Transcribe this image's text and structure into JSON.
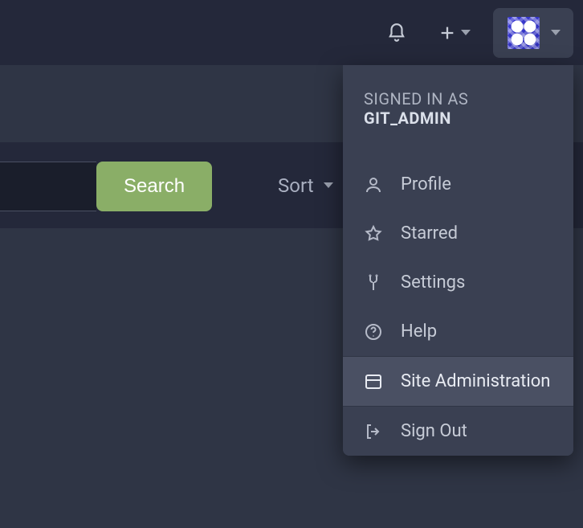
{
  "navbar": {
    "notifications_icon": "bell-icon",
    "create_icon": "plus-icon",
    "avatar_alt": "user avatar"
  },
  "toolbar": {
    "search_label": "Search",
    "search_value": "",
    "sort_label": "Sort"
  },
  "user_menu": {
    "signed_in_prefix": "SIGNED IN AS ",
    "username": "GIT_ADMIN",
    "items": [
      {
        "label": "Profile",
        "icon": "user-icon"
      },
      {
        "label": "Starred",
        "icon": "star-icon"
      },
      {
        "label": "Settings",
        "icon": "wrench-icon"
      },
      {
        "label": "Help",
        "icon": "help-icon"
      }
    ],
    "admin_item": {
      "label": "Site Administration",
      "icon": "server-icon"
    },
    "signout_item": {
      "label": "Sign Out",
      "icon": "signout-icon"
    }
  }
}
